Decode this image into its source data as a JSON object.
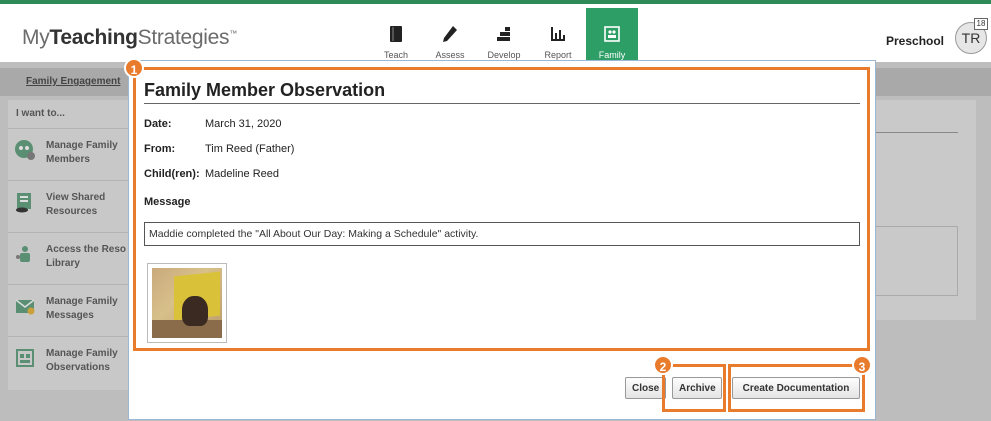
{
  "header": {
    "logo_light1": "My",
    "logo_bold": "Teaching",
    "logo_light2": "Strategies",
    "logo_tm": "™",
    "program": "Preschool",
    "avatar_initials": "TR",
    "avatar_badge": "18",
    "nav": [
      {
        "label": "Teach",
        "icon": "book-icon"
      },
      {
        "label": "Assess",
        "icon": "pencil-icon"
      },
      {
        "label": "Develop",
        "icon": "blocks-icon"
      },
      {
        "label": "Report",
        "icon": "bar-chart-icon"
      },
      {
        "label": "Family",
        "icon": "family-icon",
        "active": true
      }
    ]
  },
  "subnav": {
    "link": "Family Engagement"
  },
  "sidebar": {
    "heading": "I want to...",
    "items": [
      {
        "label": "Manage Family\nMembers",
        "icon": "family-members-icon"
      },
      {
        "label": "View Shared\nResources",
        "icon": "shared-resources-icon"
      },
      {
        "label": "Access the Reso\nLibrary",
        "icon": "resource-library-icon"
      },
      {
        "label": "Manage Family\nMessages",
        "icon": "messages-icon"
      },
      {
        "label": "Manage Family\nObservations",
        "icon": "observations-icon"
      }
    ]
  },
  "modal": {
    "title": "Family Member Observation",
    "date_label": "Date:",
    "date_value": "March 31, 2020",
    "from_label": "From:",
    "from_value": "Tim Reed (Father)",
    "children_label": "Child(ren):",
    "children_value": "Madeline Reed",
    "message_label": "Message",
    "message_text": "Maddie completed the \"All About Our Day: Making a Schedule\" activity.",
    "buttons": {
      "close": "Close",
      "archive": "Archive",
      "create": "Create Documentation"
    }
  },
  "callouts": [
    "1",
    "2",
    "3"
  ],
  "colors": {
    "accent": "#2e9e67",
    "callout": "#e97b2c"
  }
}
